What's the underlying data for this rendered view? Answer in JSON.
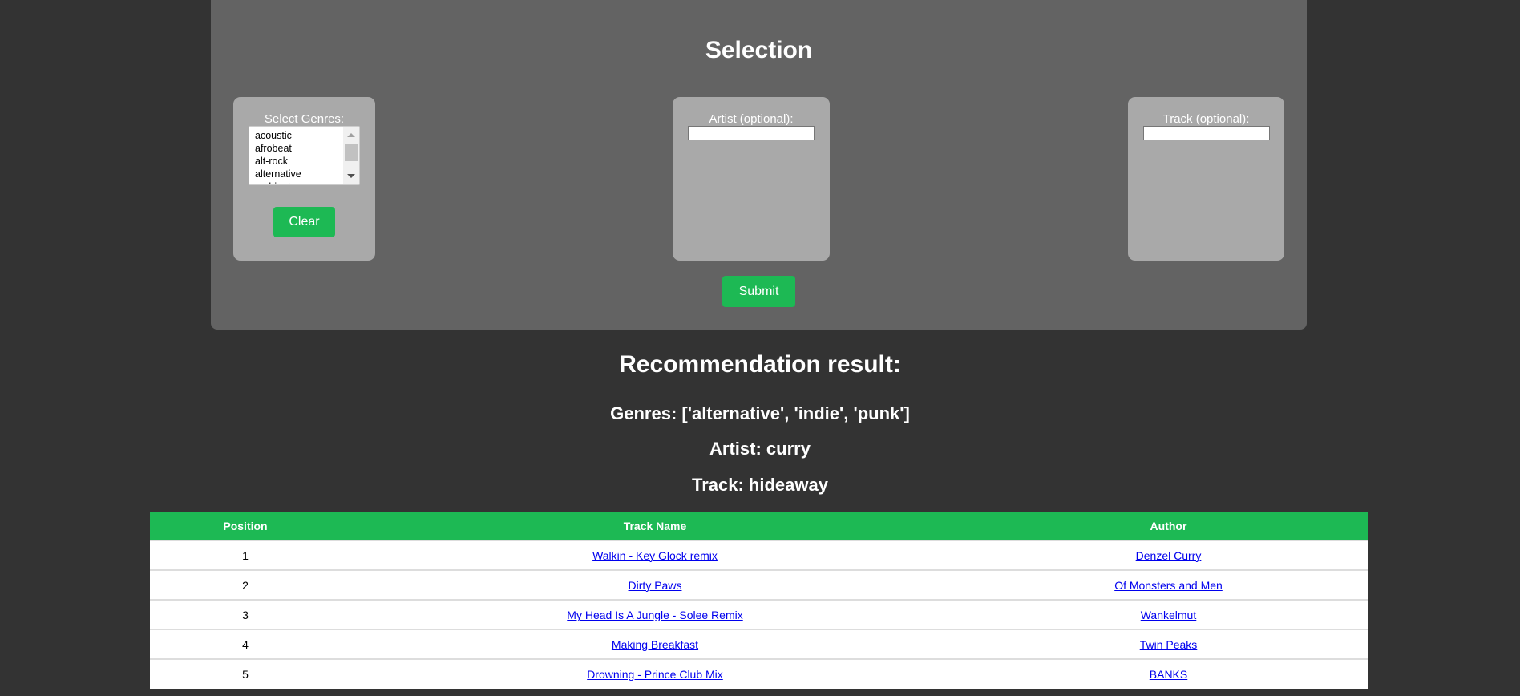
{
  "selection": {
    "title": "Selection",
    "genres": {
      "label": "Select Genres:",
      "options": [
        "acoustic",
        "afrobeat",
        "alt-rock",
        "alternative",
        "ambient"
      ],
      "clear_label": "Clear"
    },
    "artist": {
      "label": "Artist (optional):",
      "value": ""
    },
    "track": {
      "label": "Track (optional):",
      "value": ""
    },
    "submit_label": "Submit"
  },
  "result": {
    "title": "Recommendation result:",
    "genres": "Genres: ['alternative', 'indie', 'punk']",
    "artist": "Artist: curry",
    "track": "Track: hideaway"
  },
  "table": {
    "headers": [
      "Position",
      "Track Name",
      "Author"
    ],
    "rows": [
      {
        "position": "1",
        "track": "Walkin - Key Glock remix",
        "author": "Denzel Curry"
      },
      {
        "position": "2",
        "track": "Dirty Paws",
        "author": "Of Monsters and Men"
      },
      {
        "position": "3",
        "track": "My Head Is A Jungle - Solee Remix",
        "author": "Wankelmut"
      },
      {
        "position": "4",
        "track": "Making Breakfast",
        "author": "Twin Peaks"
      },
      {
        "position": "5",
        "track": "Drowning - Prince Club Mix",
        "author": "BANKS"
      }
    ]
  }
}
